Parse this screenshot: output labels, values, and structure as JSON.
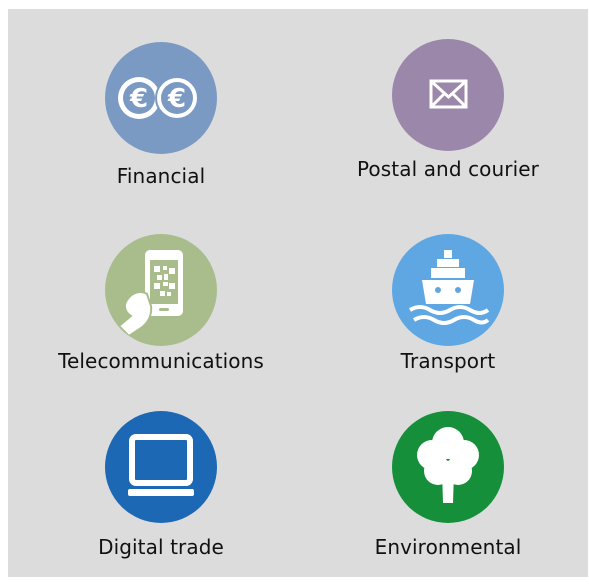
{
  "colors": {
    "background": "#dcdcdc",
    "financial": "#7b9ac3",
    "postal": "#9b87aa",
    "telecom": "#a9bd8c",
    "transport": "#5ea7e3",
    "digital": "#1d68b5",
    "environmental": "#168f3a"
  },
  "categories": [
    {
      "id": "financial",
      "label": "Financial",
      "icon": "euro-coins-icon"
    },
    {
      "id": "postal",
      "label": "Postal and courier",
      "icon": "envelope-icon"
    },
    {
      "id": "telecom",
      "label": "Telecommunications",
      "icon": "phone-qr-icon"
    },
    {
      "id": "transport",
      "label": "Transport",
      "icon": "ship-icon"
    },
    {
      "id": "digital",
      "label": "Digital trade",
      "icon": "monitor-icon"
    },
    {
      "id": "environmental",
      "label": "Environmental",
      "icon": "tree-icon"
    }
  ]
}
